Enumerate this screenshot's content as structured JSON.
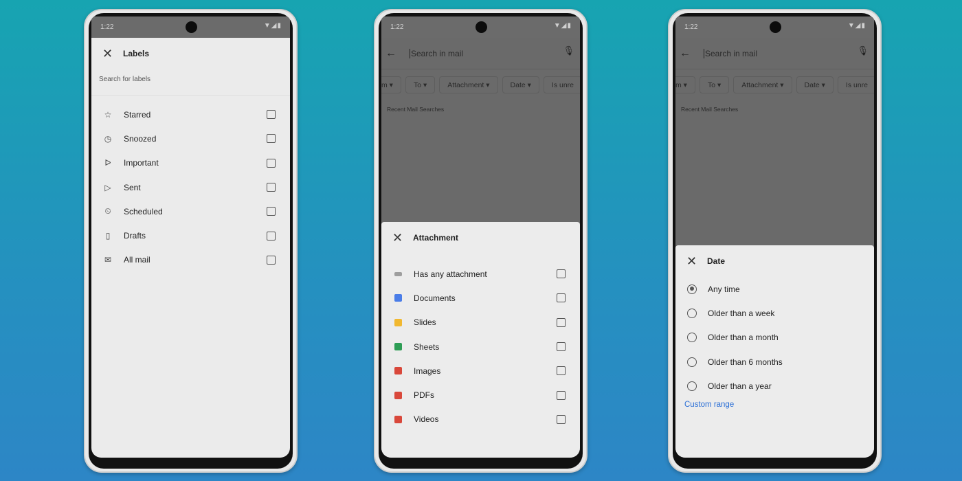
{
  "status": {
    "time": "1:22",
    "icons": "▼◢▮"
  },
  "labels_screen": {
    "title": "Labels",
    "search_placeholder": "Search for labels",
    "items": [
      {
        "label": "Starred",
        "icon": "☆"
      },
      {
        "label": "Snoozed",
        "icon": "◷"
      },
      {
        "label": "Important",
        "icon": "ᐅ"
      },
      {
        "label": "Sent",
        "icon": "▷"
      },
      {
        "label": "Scheduled",
        "icon": "⏲"
      },
      {
        "label": "Drafts",
        "icon": "▯"
      },
      {
        "label": "All mail",
        "icon": "✉"
      }
    ]
  },
  "search": {
    "placeholder": "Search in mail",
    "chips": [
      "m ▾",
      "To ▾",
      "Attachment ▾",
      "Date ▾",
      "Is unre"
    ],
    "recent": "Recent Mail Searches"
  },
  "attachment_sheet": {
    "title": "Attachment",
    "items": [
      {
        "label": "Has any attachment",
        "color": "#9e9e9e"
      },
      {
        "label": "Documents",
        "color": "#4a7de8"
      },
      {
        "label": "Slides",
        "color": "#f1b830"
      },
      {
        "label": "Sheets",
        "color": "#2e9d55"
      },
      {
        "label": "Images",
        "color": "#d9483b"
      },
      {
        "label": "PDFs",
        "color": "#d9483b"
      },
      {
        "label": "Videos",
        "color": "#d9483b"
      }
    ]
  },
  "date_sheet": {
    "title": "Date",
    "options": [
      "Any time",
      "Older than a week",
      "Older than a month",
      "Older than 6 months",
      "Older than a year"
    ],
    "selected": 0,
    "custom": "Custom range"
  }
}
